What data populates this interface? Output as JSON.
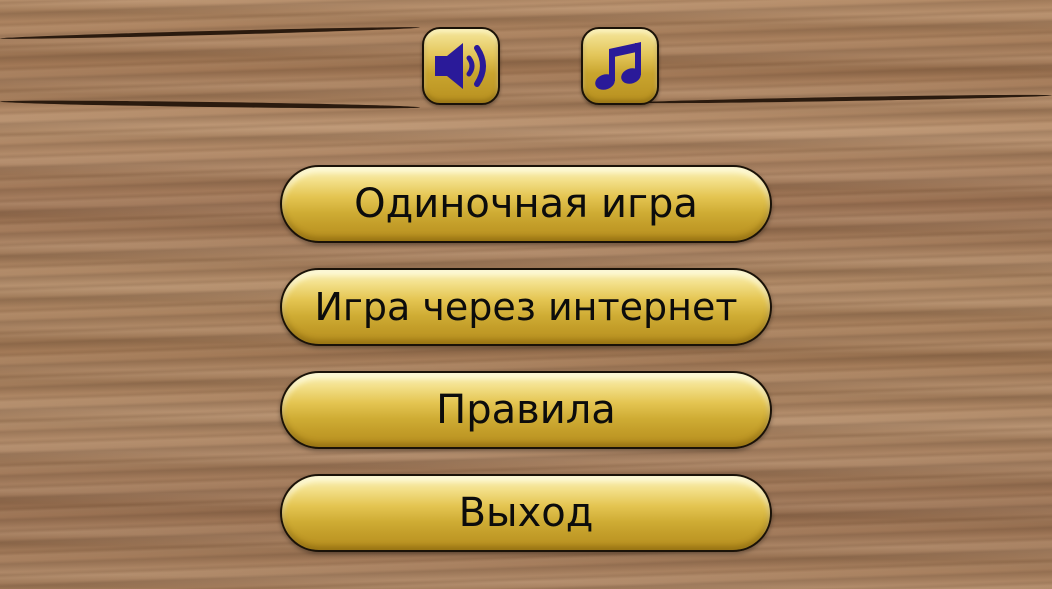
{
  "top_controls": {
    "sound_icon": "speaker-icon",
    "music_icon": "music-note-icon",
    "icon_color": "#2a1a99"
  },
  "menu": {
    "single_player": "Одиночная игра",
    "online_play": "Игра через интернет",
    "rules": "Правила",
    "exit": "Выход"
  },
  "colors": {
    "button_gold": "#e4c552",
    "button_border": "#1a1208",
    "text": "#0c0c0c",
    "wood": "#a87f5c"
  }
}
